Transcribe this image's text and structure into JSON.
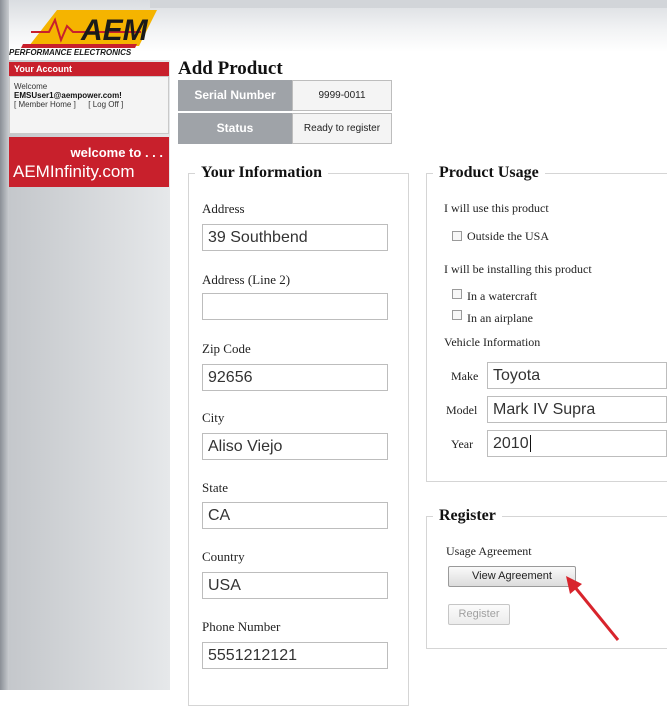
{
  "brand": {
    "logo_text": "AEM",
    "tagline": "PERFORMANCE ELECTRONICS"
  },
  "account": {
    "header": "Your Account",
    "welcome": "Welcome",
    "email": "EMSUser1@aempower.com!",
    "member_home": "[ Member Home ]",
    "log_off": "[ Log Off ]"
  },
  "promo": {
    "line1": "welcome to . . .",
    "line2": "AEMInfinity.com"
  },
  "page": {
    "title": "Add Product"
  },
  "product": {
    "serial_label": "Serial Number",
    "serial_value": "9999-0011",
    "status_label": "Status",
    "status_value": "Ready to register"
  },
  "your_information": {
    "legend": "Your Information",
    "address_label": "Address",
    "address_value": "39 Southbend",
    "address2_label": "Address (Line 2)",
    "address2_value": "",
    "zip_label": "Zip Code",
    "zip_value": "92656",
    "city_label": "City",
    "city_value": "Aliso Viejo",
    "state_label": "State",
    "state_value": "CA",
    "country_label": "Country",
    "country_value": "USA",
    "phone_label": "Phone Number",
    "phone_value": "5551212121"
  },
  "product_usage": {
    "legend": "Product Usage",
    "use_label": "I will use this product",
    "outside_usa": "Outside the USA",
    "installing_label": "I will be installing this product",
    "watercraft": "In a watercraft",
    "airplane": "In an airplane",
    "vehicle_info_label": "Vehicle Information",
    "make_label": "Make",
    "make_value": "Toyota",
    "model_label": "Model",
    "model_value": "Mark IV Supra",
    "year_label": "Year",
    "year_value": "2010"
  },
  "register": {
    "legend": "Register",
    "agreement_label": "Usage Agreement",
    "view_agreement_button": "View Agreement",
    "register_button": "Register"
  },
  "colors": {
    "brand_red": "#c8202c",
    "accent_yellow": "#f5b400",
    "arrow_red": "#d8242c"
  }
}
